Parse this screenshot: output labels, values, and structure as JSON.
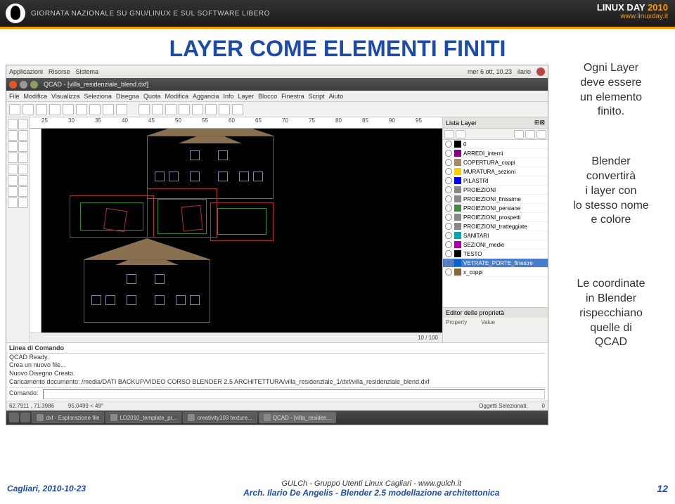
{
  "topbar": {
    "subtitle": "GIORNATA NAZIONALE SU GNU/LINUX E SUL SOFTWARE LIBERO",
    "logo_main": "LINUX DAY",
    "logo_year": "2010",
    "logo_url": "www.linuxday.it"
  },
  "slide": {
    "title": "LAYER COME ELEMENTI FINITI"
  },
  "desktop_panel": {
    "apps": "Applicazioni",
    "places": "Risorse",
    "system": "Sistema",
    "clock": "mer 6 ott, 10.23",
    "user": "ilario"
  },
  "window": {
    "title": "QCAD - [villa_residenziale_blend.dxf]"
  },
  "menubar": {
    "items": [
      "File",
      "Modifica",
      "Visualizza",
      "Seleziona",
      "Disegna",
      "Quota",
      "Modifica",
      "Aggancia",
      "Info",
      "Layer",
      "Blocco",
      "Finestra",
      "Script",
      "Aiuto"
    ]
  },
  "ruler": {
    "ticks": [
      "25",
      "30",
      "35",
      "40",
      "45",
      "50",
      "55",
      "60",
      "65",
      "70",
      "75",
      "80",
      "85",
      "90",
      "95"
    ]
  },
  "layer_panel": {
    "title": "Lista Layer",
    "layers": [
      {
        "name": "0",
        "color": "#000"
      },
      {
        "name": "ARREDI_interni",
        "color": "#808"
      },
      {
        "name": "COPERTURA_coppi",
        "color": "#a86"
      },
      {
        "name": "MURATURA_sezioni",
        "color": "#fc0"
      },
      {
        "name": "PILASTRI",
        "color": "#00f"
      },
      {
        "name": "PROIEZIONI",
        "color": "#888"
      },
      {
        "name": "PROIEZIONI_finissime",
        "color": "#888"
      },
      {
        "name": "PROIEZIONI_persiane",
        "color": "#484"
      },
      {
        "name": "PROIEZIONI_prospetti",
        "color": "#888"
      },
      {
        "name": "PROIEZIONI_tratteggiate",
        "color": "#888"
      },
      {
        "name": "SANITARI",
        "color": "#0aa"
      },
      {
        "name": "SEZIONI_medie",
        "color": "#a0a"
      },
      {
        "name": "TESTO",
        "color": "#000"
      },
      {
        "name": "VETRATE_PORTE_finestre",
        "color": "#06c",
        "sel": true
      },
      {
        "name": "x_coppi",
        "color": "#863"
      }
    ]
  },
  "prop_panel": {
    "title": "Editor delle proprietà",
    "col1": "Property",
    "col2": "Value"
  },
  "cmd": {
    "label": "Linea di Comando",
    "line1": "QCAD Ready.",
    "line2": "Crea un nuovo file...",
    "line3": "Nuovo Disegno Creato.",
    "line4": "Caricamento documento: /media/DATI BACKUP/VIDEO CORSO BLENDER 2.5 ARCHITETTURA/villa_residenziale_1/dxf/villa_residenziale_blend.dxf",
    "prompt": "Comando:"
  },
  "status": {
    "coords": "62.7911 , 71.3986",
    "rel": "95.0499 < 49°",
    "sel_label": "Oggetti Selezionati:",
    "sel_count": "0"
  },
  "canvas_status": "10 / 100",
  "taskbar": {
    "items": [
      {
        "label": "dxf - Esplorazione file"
      },
      {
        "label": "LD2010_template_pr..."
      },
      {
        "label": "creativity103 texture..."
      },
      {
        "label": "QCAD - [villa_residen...",
        "active": true
      }
    ]
  },
  "side": {
    "p1a": "Ogni Layer",
    "p1b": "deve essere",
    "p1c": "un elemento",
    "p1d": "finito.",
    "p2a": "Blender",
    "p2b": "convertirà",
    "p2c": "i layer con",
    "p2d": "lo stesso nome",
    "p2e": "e colore",
    "p3a": "Le coordinate",
    "p3b": "in Blender",
    "p3c": "rispecchiano",
    "p3d": "quelle di",
    "p3e": "QCAD"
  },
  "footer": {
    "left": "Cagliari, 2010-10-23",
    "center1": "GULCh - Gruppo Utenti Linux Cagliari - www.gulch.it",
    "center2": "Arch. Ilario De Angelis  - Blender 2.5 modellazione architettonica",
    "page": "12"
  }
}
